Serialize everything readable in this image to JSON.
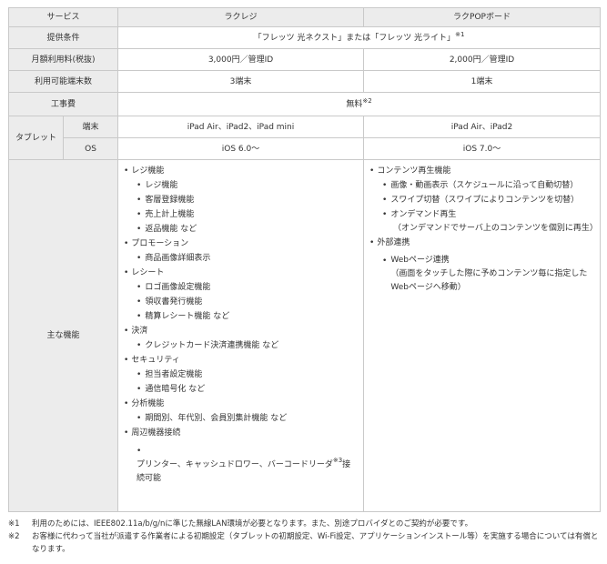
{
  "table": {
    "header": {
      "service": "サービス",
      "col1": "ラクレジ",
      "col2": "ラクPOPボード"
    },
    "rows": {
      "conditions": {
        "label": "提供条件",
        "value": "「フレッツ 光ネクスト」または「フレッツ 光ライト」",
        "note": "※1"
      },
      "monthly_fee": {
        "label": "月額利用料(税抜)",
        "col1": "3,000円／管理ID",
        "col2": "2,000円／管理ID"
      },
      "terminals": {
        "label": "利用可能端末数",
        "col1": "3端末",
        "col2": "1端末"
      },
      "construction": {
        "label": "工事費",
        "value": "無料",
        "note": "※2"
      },
      "tablet": {
        "label": "タブレット",
        "device": {
          "label": "端末",
          "col1": "iPad Air、iPad2、iPad mini",
          "col2": "iPad Air、iPad2"
        },
        "os": {
          "label": "OS",
          "col1": "iOS 6.0～",
          "col2": "iOS 7.0～"
        }
      },
      "features": {
        "label": "主な機能",
        "col1": {
          "register": {
            "title": "レジ機能",
            "items": [
              "レジ機能",
              "客層登録機能",
              "売上計上機能",
              "返品機能 など"
            ]
          },
          "promotion": {
            "title": "プロモーション",
            "items": [
              "商品画像詳細表示"
            ]
          },
          "receipt": {
            "title": "レシート",
            "items": [
              "ロゴ画像設定機能",
              "領収書発行機能",
              "精算レシート機能 など"
            ]
          },
          "payment": {
            "title": "決済",
            "items": [
              "クレジットカード決済連携機能 など"
            ]
          },
          "security": {
            "title": "セキュリティ",
            "items": [
              "担当者設定機能",
              "通信暗号化 など"
            ]
          },
          "analysis": {
            "title": "分析機能",
            "items": [
              "期間別、年代別、会員別集計機能 など"
            ]
          },
          "peripheral": {
            "title": "周辺機器接続",
            "item_before": "プリンター、キャッシュドロワー、バーコードリーダ",
            "item_note": "※3",
            "item_after": "接続可能"
          }
        },
        "col2": {
          "content": {
            "title": "コンテンツ再生機能",
            "item1": "画像・動画表示（スケジュールに沿って自動切替）",
            "item2": "スワイプ切替（スワイプによりコンテンツを切替）",
            "item3": "オンデマンド再生",
            "item3_note": "（オンデマンドでサーバ上のコンテンツを個別に再生）"
          },
          "external": {
            "title": "外部連携",
            "item1": "Webページ連携",
            "item1_note": "（画面をタッチした際に予めコンテンツ毎に指定したWebページへ移動）"
          }
        }
      }
    }
  },
  "footnotes": [
    {
      "mark": "※1",
      "text": "利用のためには、IEEE802.11a/b/g/nに準じた無線LAN環境が必要となります。また、別途プロバイダとのご契約が必要です。"
    },
    {
      "mark": "※2",
      "text": "お客様に代わって当社が派遣する作業者による初期設定（タブレットの初期設定、Wi-Fi設定、アプリケーションインストール等）を実施する場合については有償となります。"
    }
  ]
}
